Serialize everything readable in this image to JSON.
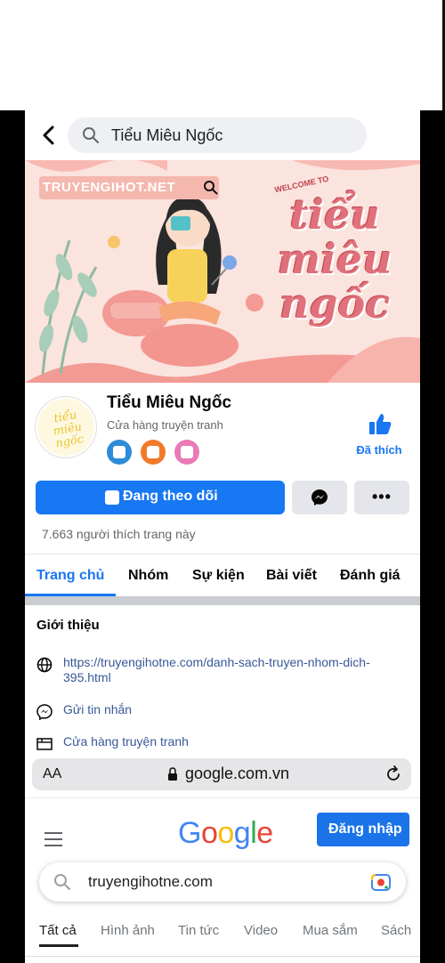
{
  "search": {
    "query": "Tiểu Miêu Ngốc"
  },
  "cover": {
    "site_badge": "TRUYENGIHOT.NET",
    "welcome": "WELCOME TO",
    "title": "tiểu miêu ngốc"
  },
  "page": {
    "name": "Tiểu Miêu Ngốc",
    "category": "Cửa hàng truyện tranh",
    "liked_label": "Đã thích",
    "avatar_text": "tiểu miêu ngốc"
  },
  "actions": {
    "follow_label": "Đang theo dõi",
    "more_label": "•••"
  },
  "likes": "7.663 người thích trang này",
  "tabs": [
    "Trang chủ",
    "Nhóm",
    "Sự kiện",
    "Bài viết",
    "Đánh giá"
  ],
  "intro": {
    "title": "Giới thiệu",
    "website": "https://truyengihotne.com/danh-sach-truyen-nhom-dich-395.html",
    "message": "Gửi tin nhắn",
    "category": "Cửa hàng truyện tranh"
  },
  "browser": {
    "aa": "AA",
    "domain": "google.com.vn"
  },
  "google": {
    "login": "Đăng nhập",
    "query": "truyengihotne.com",
    "tabs": [
      "Tất cả",
      "Hình ảnh",
      "Tin tức",
      "Video",
      "Mua sắm",
      "Sách"
    ]
  },
  "colors": {
    "facebook_blue": "#1877f2",
    "google_blue": "#1a73e8",
    "cover_pink": "#fbe3de"
  }
}
